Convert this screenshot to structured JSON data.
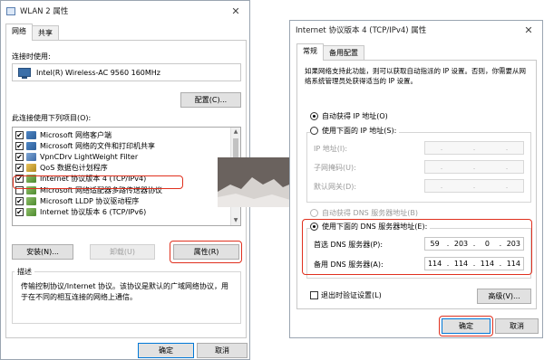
{
  "left_dialog": {
    "title": "WLAN 2 属性",
    "tabs": [
      "网络",
      "共享"
    ],
    "connect_using_label": "连接时使用:",
    "adapter_name": "Intel(R) Wireless-AC 9560 160MHz",
    "configure_button": "配置(C)...",
    "items_label": "此连接使用下列项目(O):",
    "items": [
      {
        "label": "Microsoft 网络客户端",
        "checked": "✔"
      },
      {
        "label": "Microsoft 网络的文件和打印机共享",
        "checked": "✔"
      },
      {
        "label": "VpnCDrv LightWeight Filter",
        "checked": "✔"
      },
      {
        "label": "QoS 数据包计划程序",
        "checked": "✔"
      },
      {
        "label": "Internet 协议版本 4 (TCP/IPv4)",
        "checked": "✔"
      },
      {
        "label": "Microsoft 网络适配器多路传送器协议",
        "checked": ""
      },
      {
        "label": "Microsoft LLDP 协议驱动程序",
        "checked": "✔"
      },
      {
        "label": "Internet 协议版本 6 (TCP/IPv6)",
        "checked": "✔"
      }
    ],
    "install_button": "安装(N)...",
    "uninstall_button": "卸载(U)",
    "properties_button": "属性(R)",
    "description_title": "描述",
    "description_text_1": "传输控制协议/Internet 协议。该协议是默认的广域网络协议，用",
    "description_text_2": "于在不同的相互连接的网络上通信。",
    "ok_button": "确定",
    "cancel_button": "取消"
  },
  "right_dialog": {
    "title": "Internet 协议版本 4 (TCP/IPv4) 属性",
    "tabs": [
      "常规",
      "备用配置"
    ],
    "intro_1": "如果网络支持此功能，则可以获取自动指派的 IP 设置。否则，你需要从网",
    "intro_2": "络系统管理员处获得适当的 IP 设置。",
    "auto_ip": "自动获得 IP 地址(O)",
    "manual_ip": "使用下面的 IP 地址(S):",
    "ip_address_label": "IP 地址(I):",
    "subnet_label": "子网掩码(U):",
    "gateway_label": "默认网关(D):",
    "auto_dns": "自动获得 DNS 服务器地址(B)",
    "manual_dns": "使用下面的 DNS 服务器地址(E):",
    "preferred_dns_label": "首选 DNS 服务器(P):",
    "preferred_dns": [
      "59",
      "203",
      "0",
      "203"
    ],
    "alternate_dns_label": "备用 DNS 服务器(A):",
    "alternate_dns": [
      "114",
      "114",
      "114",
      "114"
    ],
    "validate_label": "退出时验证设置(L)",
    "advanced_button": "高级(V)...",
    "ok_button": "确定",
    "cancel_button": "取消"
  },
  "colors": {
    "highlight": "#e0301e",
    "accent": "#0078d7"
  },
  "icons": [
    "close-icon",
    "network-adapter-icon",
    "scroll-up-icon",
    "scroll-down-icon"
  ]
}
